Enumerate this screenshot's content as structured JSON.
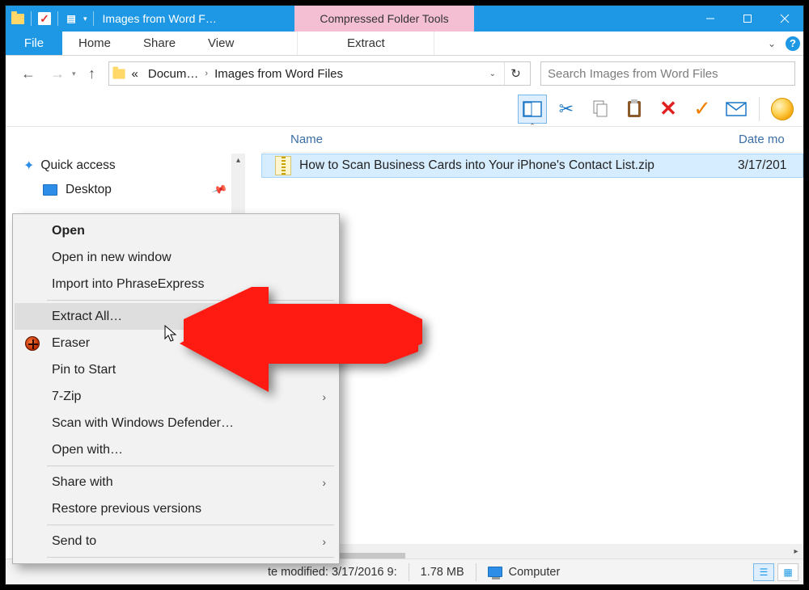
{
  "titlebar": {
    "title": "Images from Word F…",
    "context_tab": "Compressed Folder Tools"
  },
  "ribbon": {
    "file": "File",
    "home": "Home",
    "share": "Share",
    "view": "View",
    "extract": "Extract"
  },
  "nav": {
    "crumb1": "Docum…",
    "crumb2": "Images from Word Files",
    "search_placeholder": "Search Images from Word Files"
  },
  "columns": {
    "name": "Name",
    "date": "Date mo"
  },
  "sidebar": {
    "quick_access": "Quick access",
    "desktop": "Desktop"
  },
  "file": {
    "name": "How to Scan Business Cards into Your iPhone's Contact List.zip",
    "date": "3/17/201"
  },
  "contextmenu": {
    "open": "Open",
    "open_new": "Open in new window",
    "import_pe": "Import into PhraseExpress",
    "extract_all": "Extract All…",
    "eraser": "Eraser",
    "pin": "Pin to Start",
    "sevenzip": "7-Zip",
    "defender": "Scan with Windows Defender…",
    "open_with": "Open with…",
    "share_with": "Share with",
    "restore": "Restore previous versions",
    "send_to": "Send to"
  },
  "statusbar": {
    "modified": "te modified: 3/17/2016 9:",
    "size": "1.78 MB",
    "computer": "Computer"
  }
}
